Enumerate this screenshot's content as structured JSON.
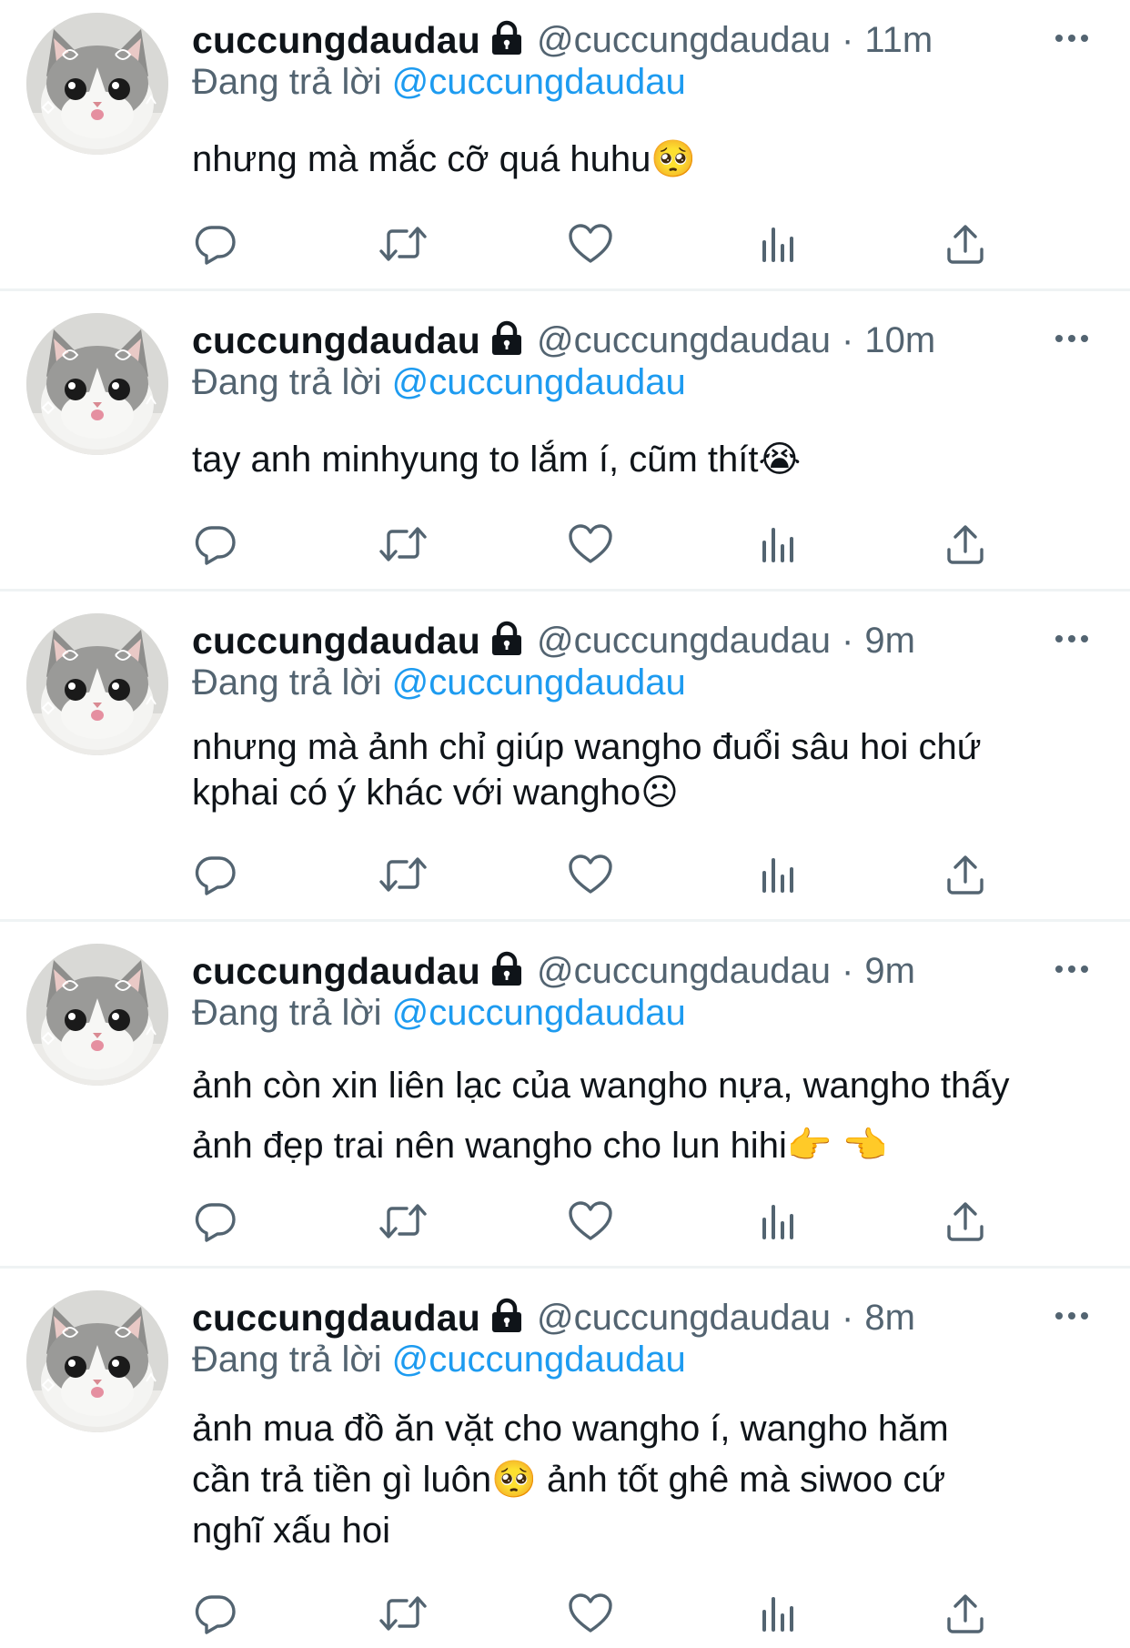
{
  "colors": {
    "text": "#0f1419",
    "secondary": "#536471",
    "link": "#1d9bf0",
    "divider": "#eff3f4"
  },
  "icons": {
    "lock": "lock-icon",
    "more": "more-dots-icon",
    "reply": "reply-icon",
    "retweet": "retweet-icon",
    "like": "heart-icon",
    "views": "analytics-icon",
    "share": "share-icon"
  },
  "tweets": [
    {
      "name": "cuccungdaudau",
      "handle": "@cuccungdaudau",
      "separator": "·",
      "time": "11m",
      "reply_prefix": "Đang trả lời",
      "reply_to": "@cuccungdaudau",
      "lines": [
        "nhưng mà mắc cỡ quá huhu🥺"
      ]
    },
    {
      "name": "cuccungdaudau",
      "handle": "@cuccungdaudau",
      "separator": "·",
      "time": "10m",
      "reply_prefix": "Đang trả lời",
      "reply_to": "@cuccungdaudau",
      "lines": [
        "tay anh minhyung to lắm í, cũm thít😭"
      ]
    },
    {
      "name": "cuccungdaudau",
      "handle": "@cuccungdaudau",
      "separator": "·",
      "time": "9m",
      "reply_prefix": "Đang trả lời",
      "reply_to": "@cuccungdaudau",
      "lines": [
        "nhưng mà ảnh chỉ giúp wangho đuổi sâu hoi chứ",
        "kphai có ý khác với wangho☹"
      ]
    },
    {
      "name": "cuccungdaudau",
      "handle": "@cuccungdaudau",
      "separator": "·",
      "time": "9m",
      "reply_prefix": "Đang trả lời",
      "reply_to": "@cuccungdaudau",
      "lines": [
        "ảnh còn xin liên lạc của wangho nựa, wangho thấy",
        "ảnh đẹp trai nên wangho cho lun hihi👉 👈"
      ]
    },
    {
      "name": "cuccungdaudau",
      "handle": "@cuccungdaudau",
      "separator": "·",
      "time": "8m",
      "reply_prefix": "Đang trả lời",
      "reply_to": "@cuccungdaudau",
      "lines": [
        "ảnh mua đồ ăn vặt cho wangho í, wangho hăm",
        "cần trả tiền gì luôn🥺  ảnh tốt ghê mà siwoo cứ",
        "nghĩ xấu hoi"
      ]
    }
  ]
}
